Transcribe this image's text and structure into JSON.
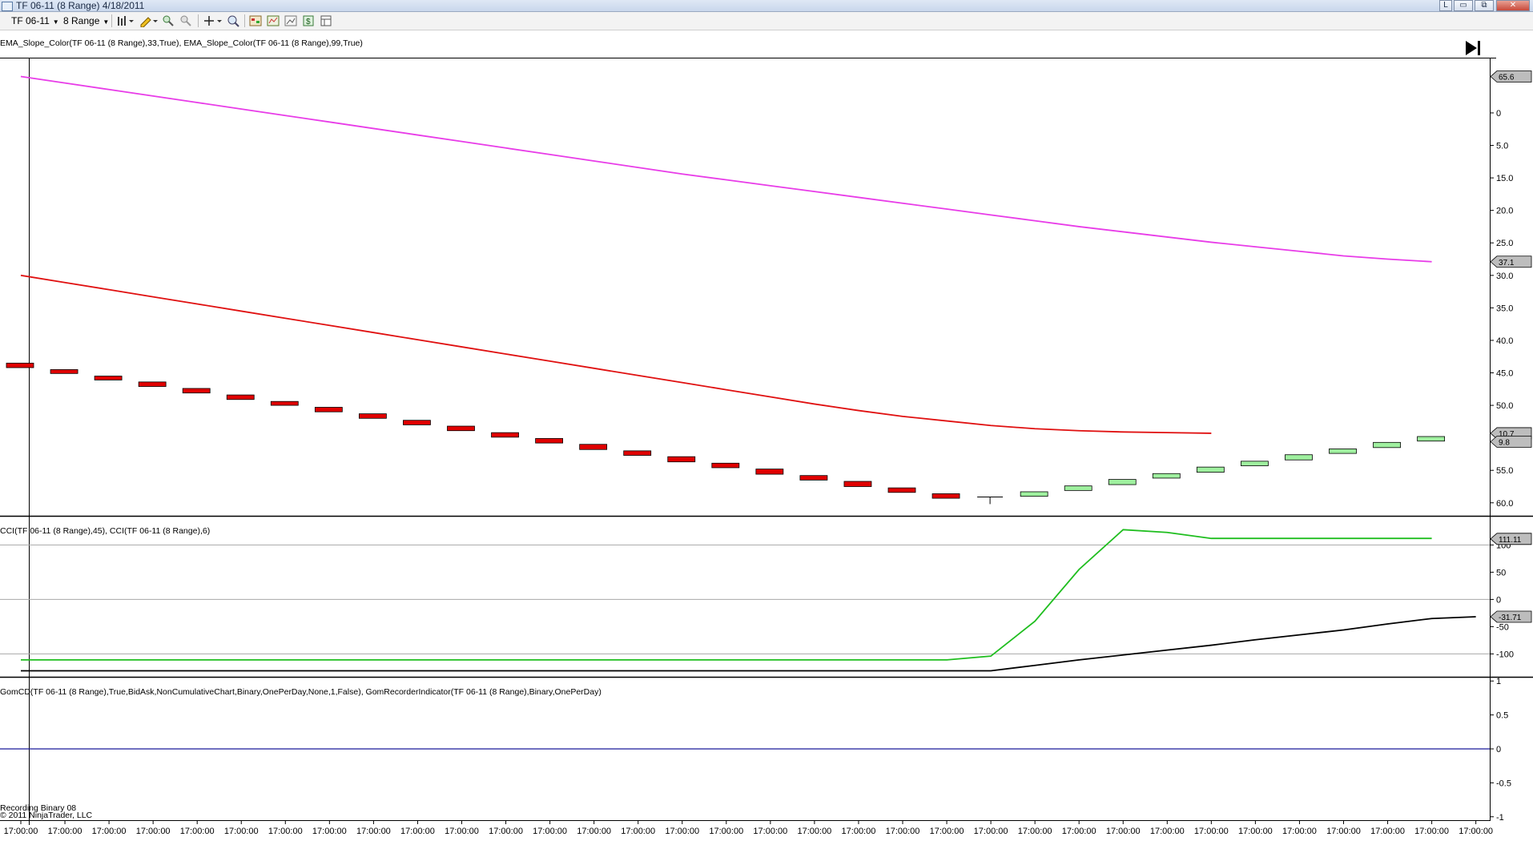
{
  "window": {
    "title": "TF 06-11 (8 Range)  4/18/2011",
    "buttons": {
      "l": "L",
      "minimize": "▭",
      "restore": "⧉",
      "close": "✕"
    }
  },
  "toolbar": {
    "instrument": "TF 06-11",
    "period": "8 Range",
    "icons": [
      "bar-style-icon",
      "pencil-draw-icon",
      "zoom-in-icon",
      "zoom-out-icon",
      "crosshair-icon",
      "magnifier-icon",
      "strategies-icon",
      "indicators-icon",
      "chart-properties-icon",
      "price-marker-icon",
      "data-box-icon"
    ]
  },
  "colors": {
    "magenta": "#e83ce8",
    "red": "#e01010",
    "green": "#1fbe1f",
    "black": "#000000",
    "navy": "#1a1a9a",
    "up_bar": "#9ff09f",
    "down_bar": "#e00000"
  },
  "panels": [
    {
      "label": "EMA_Slope_Color(TF 06-11 (8 Range),33,True), EMA_Slope_Color(TF 06-11 (8 Range),99,True)",
      "ticks": [
        "60.0",
        "55.0",
        "50.0",
        "45.0",
        "40.0",
        "35.0",
        "30.0",
        "25.0",
        "20.0",
        "15.0",
        "5.0",
        "0"
      ],
      "tags": [
        "65.6",
        "37.1",
        "10.7",
        "9.8"
      ]
    },
    {
      "label": "CCI(TF 06-11 (8 Range),45), CCI(TF 06-11 (8 Range),6)",
      "ticks": [
        "100",
        "50",
        "0",
        "-50",
        "-100"
      ],
      "tags": [
        "111.11",
        "-31.71"
      ]
    },
    {
      "label": "GomCD(TF 06-11 (8 Range),True,BidAsk,NonCumulativeChart,Binary,OnePerDay,None,1,False), GomRecorderIndicator(TF 06-11 (8 Range),Binary,OnePerDay)",
      "ticks": [
        "1",
        "0.5",
        "0",
        "-0.5",
        "-1"
      ],
      "tags": []
    }
  ],
  "footer": {
    "recording": "Recording Binary 08",
    "copyright": "© 2011 NinjaTrader, LLC"
  },
  "chart_data": [
    {
      "type": "line",
      "title": "",
      "y_ticks": [
        0,
        5,
        15,
        20,
        25,
        30,
        35,
        40,
        45,
        50,
        55,
        60
      ],
      "ylim": [
        -2,
        68.5
      ],
      "x": [
        "17:00:00",
        "17:00:00",
        "17:00:00",
        "17:00:00",
        "17:00:00",
        "17:00:00",
        "17:00:00",
        "17:00:00",
        "17:00:00",
        "17:00:00",
        "17:00:00",
        "17:00:00",
        "17:00:00",
        "17:00:00",
        "17:00:00",
        "17:00:00",
        "17:00:00",
        "17:00:00",
        "17:00:00",
        "17:00:00",
        "17:00:00",
        "17:00:00",
        "17:00:00",
        "17:00:00",
        "17:00:00",
        "17:00:00",
        "17:00:00",
        "17:00:00",
        "17:00:00",
        "17:00:00",
        "17:00:00",
        "17:00:00",
        "17:00:00",
        "17:00:00"
      ],
      "bars": [
        {
          "open": 21.5,
          "close": 20.8
        },
        {
          "open": 20.5,
          "close": 19.9
        },
        {
          "open": 19.5,
          "close": 18.9
        },
        {
          "open": 18.6,
          "close": 17.9
        },
        {
          "open": 17.6,
          "close": 16.9
        },
        {
          "open": 16.6,
          "close": 15.9
        },
        {
          "open": 15.6,
          "close": 15.0
        },
        {
          "open": 14.7,
          "close": 14.0
        },
        {
          "open": 13.7,
          "close": 13.0
        },
        {
          "open": 12.7,
          "close": 12.0
        },
        {
          "open": 11.8,
          "close": 11.1
        },
        {
          "open": 10.8,
          "close": 10.1
        },
        {
          "open": 9.9,
          "close": 9.2
        },
        {
          "open": 9.0,
          "close": 8.2
        },
        {
          "open": 8.0,
          "close": 7.3
        },
        {
          "open": 7.1,
          "close": 6.3
        },
        {
          "open": 6.1,
          "close": 5.4
        },
        {
          "open": 5.2,
          "close": 4.4
        },
        {
          "open": 4.2,
          "close": 3.5
        },
        {
          "open": 3.3,
          "close": 2.5
        },
        {
          "open": 2.3,
          "close": 1.6
        },
        {
          "open": 1.4,
          "close": 0.7
        },
        {
          "open": 0.9,
          "close": 0.9,
          "high": 0.9,
          "low": -0.2
        },
        {
          "open": 1.0,
          "close": 1.7
        },
        {
          "open": 1.9,
          "close": 2.6
        },
        {
          "open": 2.8,
          "close": 3.6
        },
        {
          "open": 3.8,
          "close": 4.5
        },
        {
          "open": 4.7,
          "close": 5.5
        },
        {
          "open": 5.7,
          "close": 6.4
        },
        {
          "open": 6.6,
          "close": 7.4
        },
        {
          "open": 7.6,
          "close": 8.3
        },
        {
          "open": 8.5,
          "close": 9.3
        },
        {
          "open": 9.5,
          "close": 10.2
        }
      ],
      "series": [
        {
          "name": "EMA 99",
          "color": "#e83ce8",
          "values": [
            65.6,
            64.6,
            63.6,
            62.6,
            61.6,
            60.6,
            59.6,
            58.6,
            57.6,
            56.6,
            55.6,
            54.6,
            53.6,
            52.6,
            51.6,
            50.6,
            49.7,
            48.8,
            47.9,
            47.0,
            46.1,
            45.2,
            44.3,
            43.4,
            42.5,
            41.7,
            40.9,
            40.1,
            39.4,
            38.7,
            38.0,
            37.5,
            37.1
          ]
        },
        {
          "name": "EMA 33",
          "color": "#e01010",
          "values": [
            35.0,
            33.9,
            32.8,
            31.7,
            30.6,
            29.5,
            28.4,
            27.3,
            26.2,
            25.1,
            24.0,
            22.9,
            21.8,
            20.7,
            19.6,
            18.5,
            17.4,
            16.3,
            15.2,
            14.2,
            13.3,
            12.6,
            11.9,
            11.4,
            11.1,
            10.9,
            10.8,
            10.7
          ]
        }
      ]
    },
    {
      "type": "line",
      "title": "",
      "y_ticks": [
        100,
        50,
        0,
        -50,
        -100
      ],
      "ylim": [
        -142,
        152
      ],
      "series": [
        {
          "name": "CCI 6",
          "color": "#1fbe1f",
          "values": [
            -111,
            -111,
            -111,
            -111,
            -111,
            -111,
            -111,
            -111,
            -111,
            -111,
            -111,
            -111,
            -111,
            -111,
            -111,
            -111,
            -111,
            -111,
            -111,
            -111,
            -111,
            -111,
            -104,
            -40,
            55,
            128,
            123,
            112,
            112,
            112,
            112,
            112,
            112
          ]
        },
        {
          "name": "CCI 45",
          "color": "#000000",
          "values": [
            -131,
            -131,
            -131,
            -131,
            -131,
            -131,
            -131,
            -131,
            -131,
            -131,
            -131,
            -131,
            -131,
            -131,
            -131,
            -131,
            -131,
            -131,
            -131,
            -131,
            -131,
            -131,
            -131,
            -121,
            -111,
            -102,
            -93,
            -84,
            -74,
            -65,
            -56,
            -45,
            -35,
            -31.7
          ]
        }
      ]
    },
    {
      "type": "line",
      "title": "",
      "y_ticks": [
        1,
        0.5,
        0,
        -0.5,
        -1
      ],
      "ylim": [
        -1.05,
        1.05
      ],
      "series": [
        {
          "name": "GomCD",
          "color": "#1a1a9a",
          "values": [
            0,
            0
          ]
        }
      ]
    }
  ]
}
